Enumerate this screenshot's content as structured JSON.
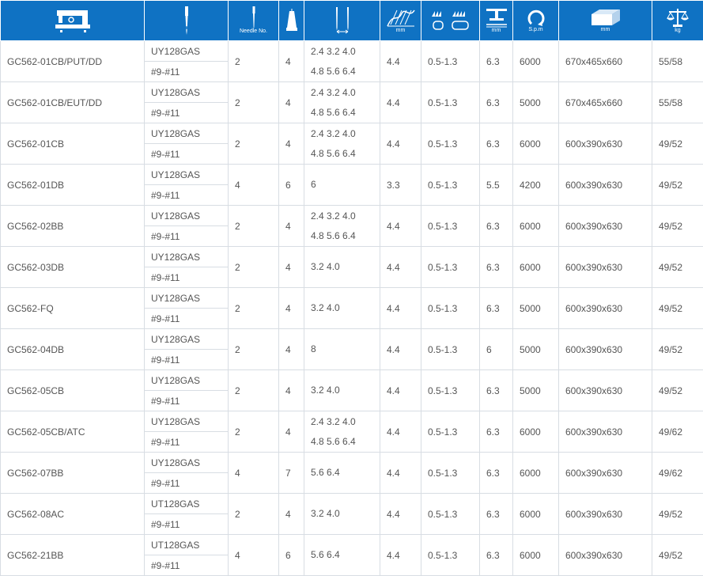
{
  "header": {
    "needle_no_caption": "Needle No.",
    "stitch_length_caption": "mm",
    "foot_lift_caption": "mm",
    "speed_caption": "S.p.m",
    "dimension_caption": "mm",
    "weight_caption": "kg",
    "icons": [
      "sewing-machine-icon",
      "needle-icon",
      "needle-count-icon",
      "thread-count-icon",
      "needle-gauge-icon",
      "stitch-length-icon",
      "differential-feed-icon",
      "presser-foot-lift-icon",
      "speed-icon",
      "package-box-icon",
      "weight-scale-icon"
    ],
    "colors": {
      "header_bg": "#0f72c3",
      "text": "#555555",
      "grid": "#d8dde3"
    }
  },
  "rows": [
    {
      "model": "GC562-01CB/PUT/DD",
      "needle_type": "UY128GAS",
      "needle_size": "#9-#11",
      "needles": "2",
      "threads": "4",
      "gauge": [
        "2.4 3.2 4.0",
        "4.8 5.6 6.4"
      ],
      "stitch": "4.4",
      "diff": "0.5-1.3",
      "lift": "6.3",
      "speed": "6000",
      "dim": "670x465x660",
      "weight": "55/58"
    },
    {
      "model": "GC562-01CB/EUT/DD",
      "needle_type": "UY128GAS",
      "needle_size": "#9-#11",
      "needles": "2",
      "threads": "4",
      "gauge": [
        "2.4 3.2 4.0",
        "4.8 5.6 6.4"
      ],
      "stitch": "4.4",
      "diff": "0.5-1.3",
      "lift": "6.3",
      "speed": "5000",
      "dim": "670x465x660",
      "weight": "55/58"
    },
    {
      "model": "GC562-01CB",
      "needle_type": "UY128GAS",
      "needle_size": "#9-#11",
      "needles": "2",
      "threads": "4",
      "gauge": [
        "2.4 3.2 4.0",
        "4.8 5.6 6.4"
      ],
      "stitch": "4.4",
      "diff": "0.5-1.3",
      "lift": "6.3",
      "speed": "6000",
      "dim": "600x390x630",
      "weight": "49/52"
    },
    {
      "model": "GC562-01DB",
      "needle_type": "UY128GAS",
      "needle_size": "#9-#11",
      "needles": "4",
      "threads": "6",
      "gauge": [
        "6"
      ],
      "stitch": "3.3",
      "diff": "0.5-1.3",
      "lift": "5.5",
      "speed": "4200",
      "dim": "600x390x630",
      "weight": "49/52"
    },
    {
      "model": "GC562-02BB",
      "needle_type": "UY128GAS",
      "needle_size": "#9-#11",
      "needles": "2",
      "threads": "4",
      "gauge": [
        "2.4 3.2 4.0",
        "4.8 5.6 6.4"
      ],
      "stitch": "4.4",
      "diff": "0.5-1.3",
      "lift": "6.3",
      "speed": "6000",
      "dim": "600x390x630",
      "weight": "49/52"
    },
    {
      "model": "GC562-03DB",
      "needle_type": "UY128GAS",
      "needle_size": "#9-#11",
      "needles": "2",
      "threads": "4",
      "gauge": [
        "3.2 4.0"
      ],
      "stitch": "4.4",
      "diff": "0.5-1.3",
      "lift": "6.3",
      "speed": "6000",
      "dim": "600x390x630",
      "weight": "49/52"
    },
    {
      "model": "GC562-FQ",
      "needle_type": "UY128GAS",
      "needle_size": "#9-#11",
      "needles": "2",
      "threads": "4",
      "gauge": [
        "3.2 4.0"
      ],
      "stitch": "4.4",
      "diff": "0.5-1.3",
      "lift": "6.3",
      "speed": "5000",
      "dim": "600x390x630",
      "weight": "49/52"
    },
    {
      "model": "GC562-04DB",
      "needle_type": "UY128GAS",
      "needle_size": "#9-#11",
      "needles": "2",
      "threads": "4",
      "gauge": [
        "8"
      ],
      "stitch": "4.4",
      "diff": "0.5-1.3",
      "lift": "6",
      "speed": "5000",
      "dim": "600x390x630",
      "weight": "49/52"
    },
    {
      "model": "GC562-05CB",
      "needle_type": "UY128GAS",
      "needle_size": "#9-#11",
      "needles": "2",
      "threads": "4",
      "gauge": [
        "3.2 4.0"
      ],
      "stitch": "4.4",
      "diff": "0.5-1.3",
      "lift": "6.3",
      "speed": "5000",
      "dim": "600x390x630",
      "weight": "49/52"
    },
    {
      "model": "GC562-05CB/ATC",
      "needle_type": "UY128GAS",
      "needle_size": "#9-#11",
      "needles": "2",
      "threads": "4",
      "gauge": [
        "2.4 3.2 4.0",
        "4.8 5.6 6.4"
      ],
      "stitch": "4.4",
      "diff": "0.5-1.3",
      "lift": "6.3",
      "speed": "6000",
      "dim": "600x390x630",
      "weight": "49/62"
    },
    {
      "model": "GC562-07BB",
      "needle_type": "UY128GAS",
      "needle_size": "#9-#11",
      "needles": "4",
      "threads": "7",
      "gauge": [
        "5.6 6.4"
      ],
      "stitch": "4.4",
      "diff": "0.5-1.3",
      "lift": "6.3",
      "speed": "6000",
      "dim": "600x390x630",
      "weight": "49/62"
    },
    {
      "model": "GC562-08AC",
      "needle_type": "UT128GAS",
      "needle_size": "#9-#11",
      "needles": "2",
      "threads": "4",
      "gauge": [
        "3.2 4.0"
      ],
      "stitch": "4.4",
      "diff": "0.5-1.3",
      "lift": "6.3",
      "speed": "6000",
      "dim": "600x390x630",
      "weight": "49/52"
    },
    {
      "model": "GC562-21BB",
      "needle_type": "UT128GAS",
      "needle_size": "#9-#11",
      "needles": "4",
      "threads": "6",
      "gauge": [
        "5.6 6.4"
      ],
      "stitch": "4.4",
      "diff": "0.5-1.3",
      "lift": "6.3",
      "speed": "6000",
      "dim": "600x390x630",
      "weight": "49/52"
    }
  ]
}
